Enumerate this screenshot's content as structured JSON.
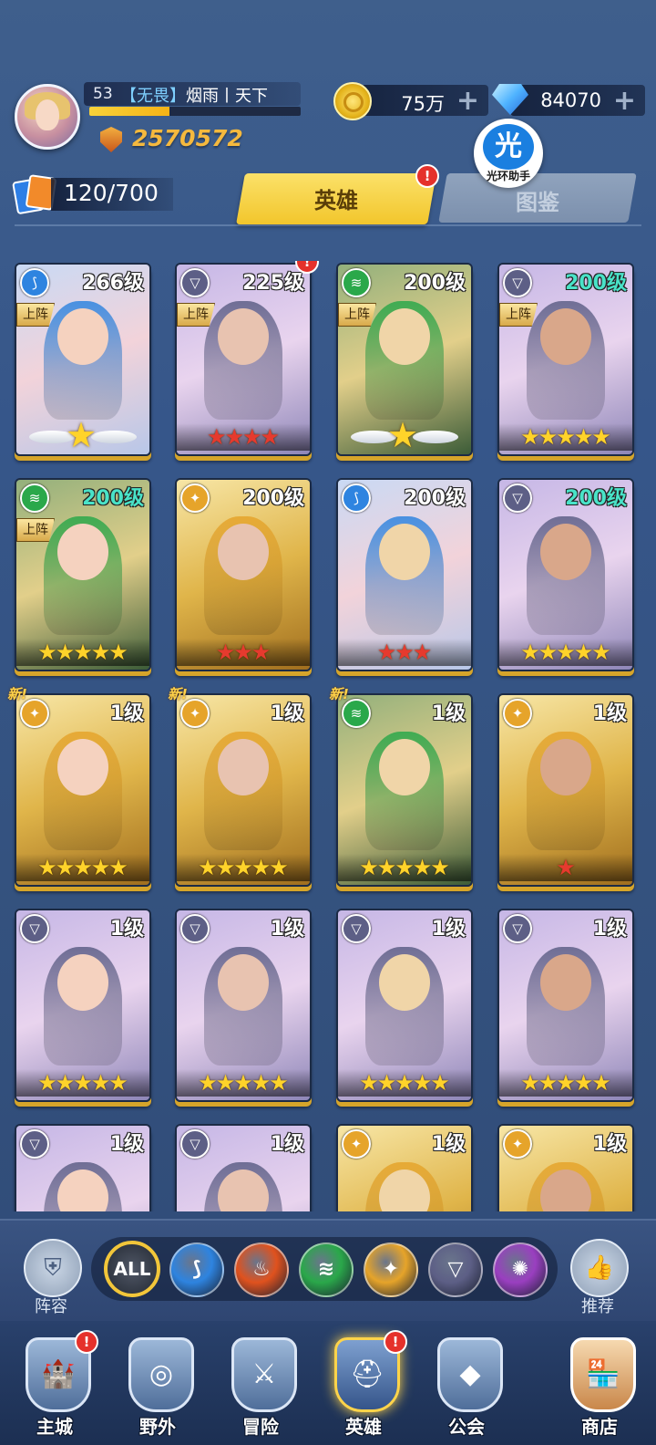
{
  "player": {
    "level": "53",
    "name_tag": "【无畏】",
    "name": "烟雨丨天下",
    "xp_progress": 0.38,
    "power": "2570572"
  },
  "resources": {
    "gold": "75万",
    "diamonds": "84070",
    "plus": "+"
  },
  "helper": {
    "glyph": "光",
    "label": "光环助手"
  },
  "hero_count": "120/700",
  "tabs": {
    "heroes": "英雄",
    "codex": "图鉴"
  },
  "alert_mark": "!",
  "new_mark": "新!",
  "on_team_label": "上阵",
  "heroes": [
    {
      "level": "266级",
      "element": "water",
      "on_team": true,
      "stars": "wing",
      "star_count": 1,
      "star_color": "yellow",
      "teal": false,
      "alert": false,
      "new": false
    },
    {
      "level": "225级",
      "element": "void",
      "on_team": true,
      "stars": "row",
      "star_count": 4,
      "star_color": "red",
      "teal": false,
      "alert": true,
      "new": false
    },
    {
      "level": "200级",
      "element": "wind",
      "on_team": true,
      "stars": "wing",
      "star_count": 1,
      "star_color": "yellow",
      "teal": false,
      "alert": false,
      "new": false
    },
    {
      "level": "200级",
      "element": "void",
      "on_team": true,
      "stars": "row",
      "star_count": 5,
      "star_color": "yellow",
      "teal": true,
      "alert": false,
      "new": false
    },
    {
      "level": "200级",
      "element": "wind",
      "on_team": true,
      "stars": "row",
      "star_count": 5,
      "star_color": "yellow",
      "teal": true,
      "alert": false,
      "new": false
    },
    {
      "level": "200级",
      "element": "light",
      "on_team": false,
      "stars": "row",
      "star_count": 3,
      "star_color": "red",
      "teal": false,
      "alert": false,
      "new": false
    },
    {
      "level": "200级",
      "element": "water",
      "on_team": false,
      "stars": "row",
      "star_count": 3,
      "star_color": "red",
      "teal": false,
      "alert": false,
      "new": false
    },
    {
      "level": "200级",
      "element": "void",
      "on_team": false,
      "stars": "row",
      "star_count": 5,
      "star_color": "yellow",
      "teal": true,
      "alert": false,
      "new": false
    },
    {
      "level": "1级",
      "element": "light",
      "on_team": false,
      "stars": "row",
      "star_count": 5,
      "star_color": "yellow",
      "teal": false,
      "alert": false,
      "new": true
    },
    {
      "level": "1级",
      "element": "light",
      "on_team": false,
      "stars": "row",
      "star_count": 5,
      "star_color": "yellow",
      "teal": false,
      "alert": false,
      "new": true
    },
    {
      "level": "1级",
      "element": "wind",
      "on_team": false,
      "stars": "row",
      "star_count": 5,
      "star_color": "yellow",
      "teal": false,
      "alert": false,
      "new": true
    },
    {
      "level": "1级",
      "element": "light",
      "on_team": false,
      "stars": "row",
      "star_count": 1,
      "star_color": "red",
      "teal": false,
      "alert": false,
      "new": false
    },
    {
      "level": "1级",
      "element": "void",
      "on_team": false,
      "stars": "row",
      "star_count": 5,
      "star_color": "yellow",
      "teal": false,
      "alert": false,
      "new": false
    },
    {
      "level": "1级",
      "element": "void",
      "on_team": false,
      "stars": "row",
      "star_count": 5,
      "star_color": "yellow",
      "teal": false,
      "alert": false,
      "new": false
    },
    {
      "level": "1级",
      "element": "void",
      "on_team": false,
      "stars": "row",
      "star_count": 5,
      "star_color": "yellow",
      "teal": false,
      "alert": false,
      "new": false
    },
    {
      "level": "1级",
      "element": "void",
      "on_team": false,
      "stars": "row",
      "star_count": 5,
      "star_color": "yellow",
      "teal": false,
      "alert": false,
      "new": false
    },
    {
      "level": "1级",
      "element": "void",
      "on_team": false,
      "stars": "none",
      "star_count": 0,
      "star_color": "yellow",
      "teal": false,
      "alert": false,
      "new": false
    },
    {
      "level": "1级",
      "element": "void",
      "on_team": false,
      "stars": "none",
      "star_count": 0,
      "star_color": "yellow",
      "teal": false,
      "alert": false,
      "new": false
    },
    {
      "level": "1级",
      "element": "light",
      "on_team": false,
      "stars": "none",
      "star_count": 0,
      "star_color": "yellow",
      "teal": false,
      "alert": false,
      "new": false
    },
    {
      "level": "1级",
      "element": "light",
      "on_team": false,
      "stars": "none",
      "star_count": 0,
      "star_color": "yellow",
      "teal": false,
      "alert": false,
      "new": false
    }
  ],
  "filter": {
    "lineup_label": "阵容",
    "recommend_label": "推荐",
    "all_label": "ALL",
    "elements": [
      "water",
      "fire",
      "wind",
      "light",
      "void",
      "dark"
    ]
  },
  "nav": [
    {
      "label": "主城",
      "alert": true,
      "active": false
    },
    {
      "label": "野外",
      "alert": false,
      "active": false
    },
    {
      "label": "冒险",
      "alert": false,
      "active": false
    },
    {
      "label": "英雄",
      "alert": true,
      "active": true
    },
    {
      "label": "公会",
      "alert": false,
      "active": false
    },
    {
      "label": "商店",
      "alert": false,
      "active": false
    }
  ],
  "colors": {
    "water": "#2e84e0",
    "fire": "#e0521e",
    "wind": "#2aa84a",
    "light": "#e6a42a",
    "void": "#5d5f86",
    "dark": "#9a3fc0",
    "accent": "#f5c62e"
  }
}
